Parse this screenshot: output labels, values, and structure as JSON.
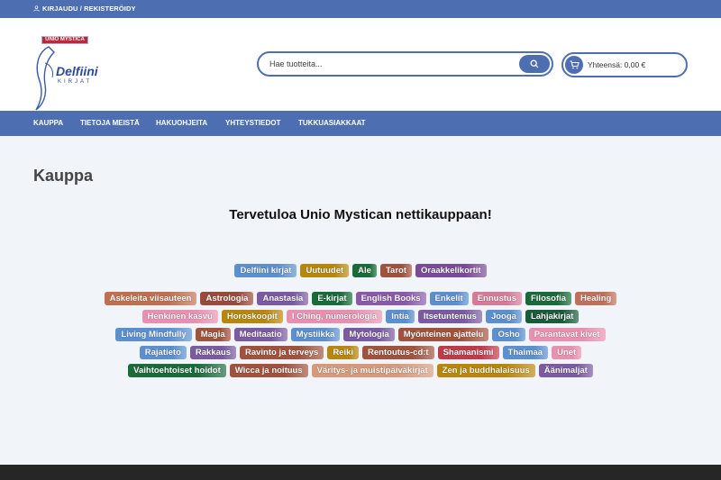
{
  "topbar": {
    "login_label": "KIRJAUDU / REKISTERÖIDY"
  },
  "logo": {
    "badge": "UNIO MYSTICA",
    "title": "Delfiini",
    "subtitle": "KIRJAT"
  },
  "search": {
    "placeholder": "Hae tuotteita..."
  },
  "cart": {
    "label": "Yhteensä: 0,00 €"
  },
  "nav": {
    "items": [
      "KAUPPA",
      "TIETOJA MEISTÄ",
      "HAKUOHJEITA",
      "YHTEYSTIEDOT",
      "TUKKUASIAKKAAT"
    ]
  },
  "page": {
    "title": "Kauppa",
    "welcome": "Tervetuloa Unio Mystican nettikauppaan!"
  },
  "featured_tags": [
    {
      "label": "Delfiini kirjat",
      "color": "#5b8fcf"
    },
    {
      "label": "Uutuudet",
      "color": "#b8860b"
    },
    {
      "label": "Ale",
      "color": "#1a6b3a"
    },
    {
      "label": "Tarot",
      "color": "#a0523d"
    },
    {
      "label": "Oraakkelikortit",
      "color": "#7a4a9a"
    }
  ],
  "tag_rows": [
    [
      {
        "label": "Askeleita viisauteen",
        "color": "#c07050"
      },
      {
        "label": "Astrologia",
        "color": "#9a4a3a"
      },
      {
        "label": "Anastasia",
        "color": "#7a5aa0"
      },
      {
        "label": "E-kirjat",
        "color": "#1a6b3a"
      },
      {
        "label": "English Books",
        "color": "#8a5aaa"
      },
      {
        "label": "Enkelit",
        "color": "#5b8fcf"
      },
      {
        "label": "Ennustus",
        "color": "#d67a9a"
      },
      {
        "label": "Filosofia",
        "color": "#1a6b3a"
      },
      {
        "label": "Healing",
        "color": "#c0705a"
      }
    ],
    [
      {
        "label": "Henkinen kasvu",
        "color": "#e890b0"
      },
      {
        "label": "Horoskoopit",
        "color": "#b8860b"
      },
      {
        "label": "I Ching, numerologia",
        "color": "#e890b0"
      },
      {
        "label": "Intia",
        "color": "#5b8fcf"
      },
      {
        "label": "Itsetuntemus",
        "color": "#7a5aa0"
      },
      {
        "label": "Jooga",
        "color": "#5b8fcf"
      },
      {
        "label": "Lahjakirjat",
        "color": "#1a5b3a"
      }
    ],
    [
      {
        "label": "Living Mindfully",
        "color": "#5b8fcf"
      },
      {
        "label": "Magia",
        "color": "#a0523d"
      },
      {
        "label": "Meditaatio",
        "color": "#7a5aa0"
      },
      {
        "label": "Mystiikka",
        "color": "#5b8fcf"
      },
      {
        "label": "Mytologia",
        "color": "#7a5aa0"
      },
      {
        "label": "Myönteinen ajattelu",
        "color": "#a0523d"
      },
      {
        "label": "Osho",
        "color": "#5b8fcf"
      },
      {
        "label": "Parantavat kivet",
        "color": "#e890b0"
      }
    ],
    [
      {
        "label": "Rajatieto",
        "color": "#5b8fcf"
      },
      {
        "label": "Rakkaus",
        "color": "#7a5aa0"
      },
      {
        "label": "Ravinto ja terveys",
        "color": "#a0523d"
      },
      {
        "label": "Reiki",
        "color": "#b8860b"
      },
      {
        "label": "Rentoutus-cd:t",
        "color": "#a0523d"
      },
      {
        "label": "Shamanismi",
        "color": "#c03a4a"
      },
      {
        "label": "Thaimaa",
        "color": "#5b8fcf"
      },
      {
        "label": "Unet",
        "color": "#e890b0"
      }
    ],
    [
      {
        "label": "Vaihtoehtoiset hoidot",
        "color": "#1a6b3a"
      },
      {
        "label": "Wicca ja noituus",
        "color": "#a0523d"
      },
      {
        "label": "Väritys- ja muistipäiväkirjat",
        "color": "#d69a7a"
      },
      {
        "label": "Zen ja buddhalaisuus",
        "color": "#b8860b"
      },
      {
        "label": "Äänimaljat",
        "color": "#7a5aa0"
      }
    ]
  ]
}
